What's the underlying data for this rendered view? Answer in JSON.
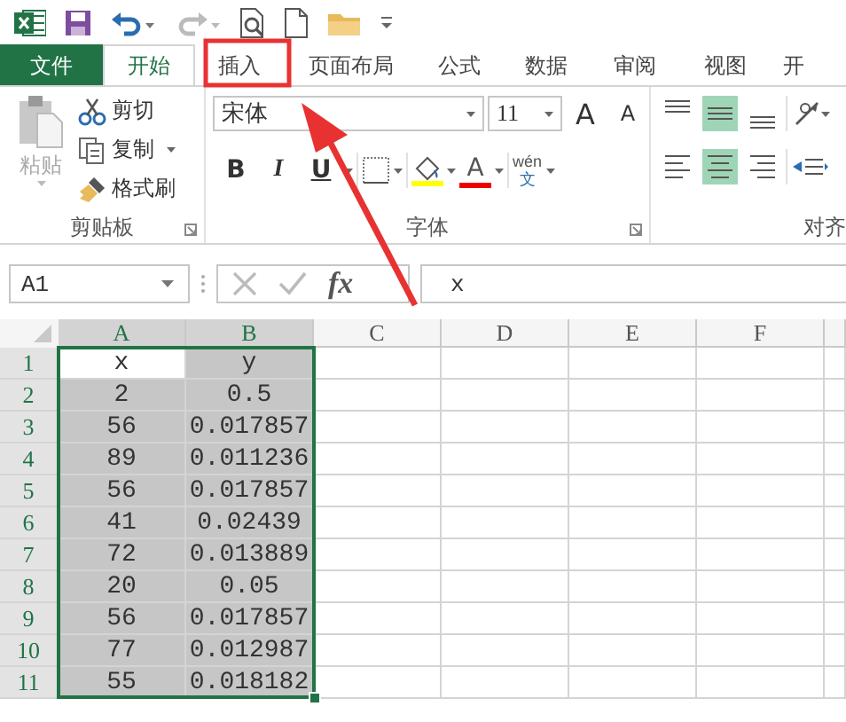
{
  "tabs": [
    {
      "label": "文件",
      "kind": "file",
      "selected": false
    },
    {
      "label": "开始",
      "kind": "tab",
      "selected": true
    },
    {
      "label": "插入",
      "kind": "tab",
      "selected": false
    },
    {
      "label": "页面布局",
      "kind": "tab",
      "selected": false
    },
    {
      "label": "公式",
      "kind": "tab",
      "selected": false
    },
    {
      "label": "数据",
      "kind": "tab",
      "selected": false
    },
    {
      "label": "审阅",
      "kind": "tab",
      "selected": false
    },
    {
      "label": "视图",
      "kind": "tab",
      "selected": false
    },
    {
      "label": "开",
      "kind": "tab",
      "selected": false
    }
  ],
  "ribbon": {
    "clipboard": {
      "label": "剪贴板",
      "paste": {
        "label": "粘贴",
        "disabled": true
      },
      "cut": "剪切",
      "copy": "复制",
      "painter": "格式刷"
    },
    "font": {
      "label": "字体",
      "name": "宋体",
      "size": "11",
      "grow": "A",
      "shrink": "A",
      "bold": "B",
      "italic": "I",
      "underline": "U",
      "color_letter": "A",
      "phonetic_top": "wén",
      "phonetic_bottom": "文"
    },
    "alignment": {
      "label": "对齐",
      "vertical": [
        {
          "kind": "top",
          "selected": false
        },
        {
          "kind": "middle",
          "selected": true
        },
        {
          "kind": "bottom",
          "selected": false
        }
      ],
      "horizontal": [
        {
          "kind": "left",
          "selected": false
        },
        {
          "kind": "center",
          "selected": true
        },
        {
          "kind": "right",
          "selected": false
        }
      ]
    }
  },
  "formula_bar": {
    "name_box": "A1",
    "value": "x",
    "function_label": "fx"
  },
  "sheet": {
    "columns": [
      {
        "label": "A",
        "selected": true
      },
      {
        "label": "B",
        "selected": true
      },
      {
        "label": "C",
        "selected": false
      },
      {
        "label": "D",
        "selected": false
      },
      {
        "label": "E",
        "selected": false
      },
      {
        "label": "F",
        "selected": false
      }
    ],
    "rows": [
      {
        "label": "1",
        "selected": true,
        "cells": [
          {
            "text": "x",
            "active": true
          },
          {
            "text": "y",
            "active": false
          }
        ]
      },
      {
        "label": "2",
        "selected": true,
        "cells": [
          {
            "text": "2",
            "active": false
          },
          {
            "text": "0.5",
            "active": false
          }
        ]
      },
      {
        "label": "3",
        "selected": true,
        "cells": [
          {
            "text": "56",
            "active": false
          },
          {
            "text": "0.017857",
            "active": false
          }
        ]
      },
      {
        "label": "4",
        "selected": true,
        "cells": [
          {
            "text": "89",
            "active": false
          },
          {
            "text": "0.011236",
            "active": false
          }
        ]
      },
      {
        "label": "5",
        "selected": true,
        "cells": [
          {
            "text": "56",
            "active": false
          },
          {
            "text": "0.017857",
            "active": false
          }
        ]
      },
      {
        "label": "6",
        "selected": true,
        "cells": [
          {
            "text": "41",
            "active": false
          },
          {
            "text": "0.02439",
            "active": false
          }
        ]
      },
      {
        "label": "7",
        "selected": true,
        "cells": [
          {
            "text": "72",
            "active": false
          },
          {
            "text": "0.013889",
            "active": false
          }
        ]
      },
      {
        "label": "8",
        "selected": true,
        "cells": [
          {
            "text": "20",
            "active": false
          },
          {
            "text": "0.05",
            "active": false
          }
        ]
      },
      {
        "label": "9",
        "selected": true,
        "cells": [
          {
            "text": "56",
            "active": false
          },
          {
            "text": "0.017857",
            "active": false
          }
        ]
      },
      {
        "label": "10",
        "selected": true,
        "cells": [
          {
            "text": "77",
            "active": false
          },
          {
            "text": "0.012987",
            "active": false
          }
        ]
      },
      {
        "label": "11",
        "selected": true,
        "cells": [
          {
            "text": "55",
            "active": false
          },
          {
            "text": "0.018182",
            "active": false
          }
        ]
      }
    ]
  }
}
